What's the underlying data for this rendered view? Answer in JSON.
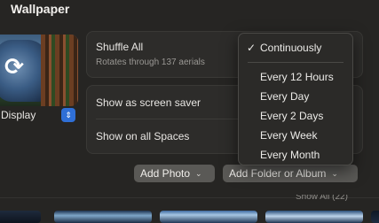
{
  "header": {
    "title": "Wallpaper"
  },
  "preview": {
    "display_label": "Display",
    "stepper_icon": "updown-chevron-icon"
  },
  "shuffle_panel": {
    "title": "Shuffle All",
    "subtitle": "Rotates through 137 aerials"
  },
  "options_panel": {
    "screensaver_label": "Show as screen saver",
    "spaces_label": "Show on all Spaces"
  },
  "buttons": {
    "add_photo": "Add Photo",
    "add_folder": "Add Folder or Album"
  },
  "gallery": {
    "show_all": "Show All (22)"
  },
  "menu": {
    "items": [
      {
        "label": "Continuously",
        "checked": true
      },
      {
        "label": "Every 12 Hours",
        "checked": false
      },
      {
        "label": "Every Day",
        "checked": false
      },
      {
        "label": "Every 2 Days",
        "checked": false
      },
      {
        "label": "Every Week",
        "checked": false
      },
      {
        "label": "Every Month",
        "checked": false
      }
    ],
    "check_glyph": "✓"
  },
  "colors": {
    "accent": "#2f6fd6",
    "background": "#262523",
    "panel": "#2d2c2a"
  }
}
